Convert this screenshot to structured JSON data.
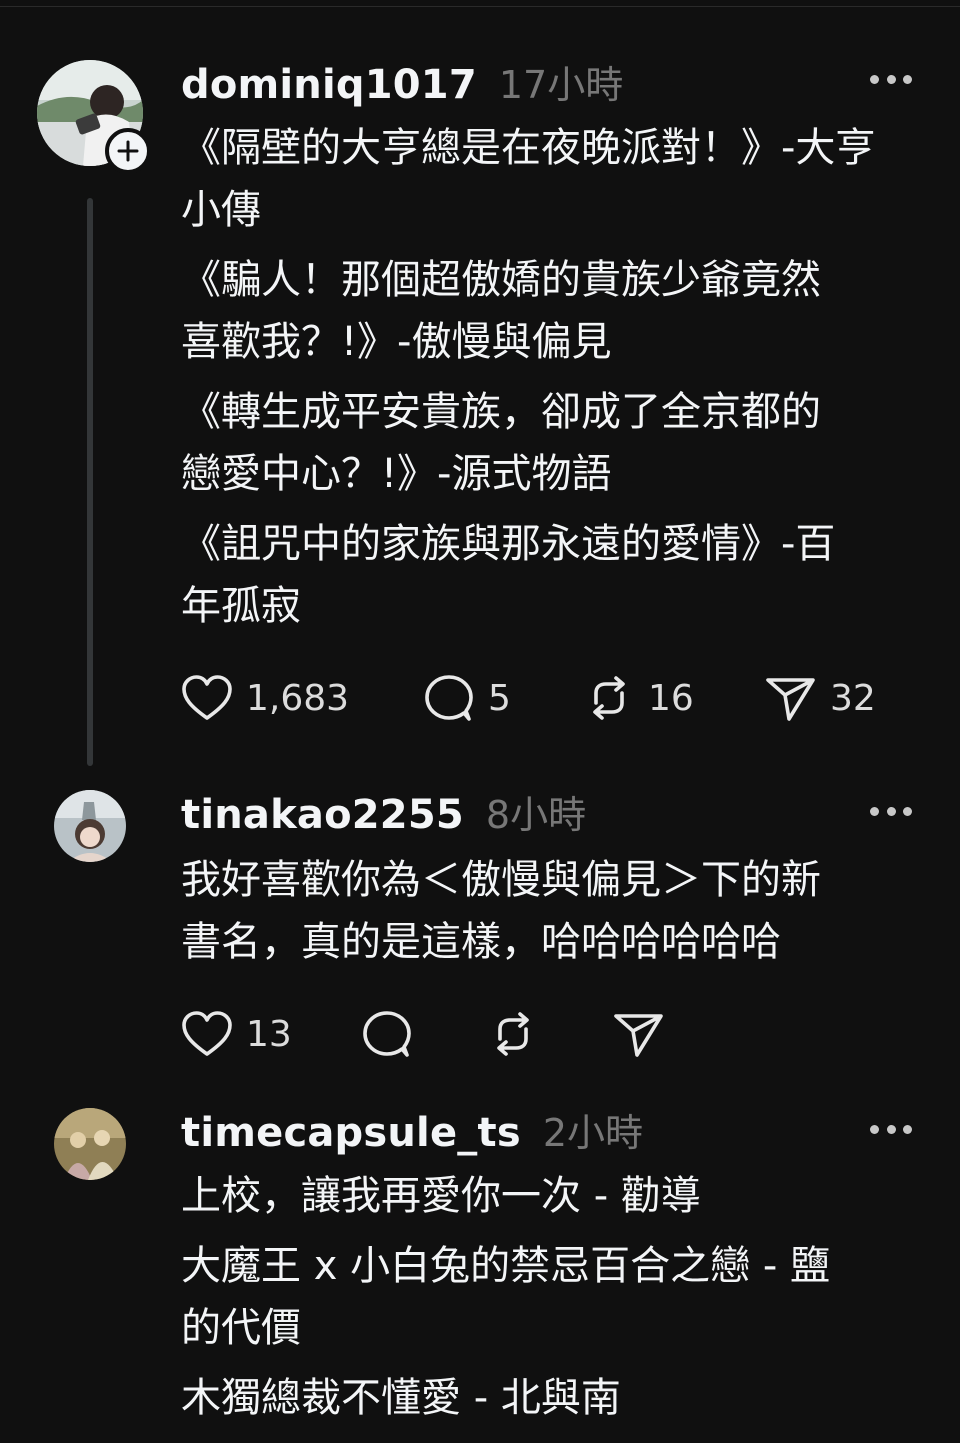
{
  "posts": [
    {
      "username": "dominiq1017",
      "time": "17小時",
      "lines": [
        "《隔壁的大亨總是在夜晚派對！》-大亨",
        "小傳",
        "《騙人！那個超傲嬌的貴族少爺竟然",
        "喜歡我？!》-傲慢與偏見",
        "《轉生成平安貴族，卻成了全京都的",
        "戀愛中心？!》-源式物語",
        "《詛咒中的家族與那永遠的愛情》-百",
        "年孤寂"
      ],
      "likes": "1,683",
      "comments": "5",
      "reposts": "16",
      "shares": "32",
      "avatar_colors": [
        "#7c8f86",
        "#d9d2c8",
        "#3a3331"
      ]
    },
    {
      "username": "tinakao2255",
      "time": "8小時",
      "lines": [
        "我好喜歡你為＜傲慢與偏見＞下的新",
        "書名，真的是這樣，哈哈哈哈哈哈"
      ],
      "likes": "13",
      "avatar_colors": [
        "#a8b0b6",
        "#e6d8cf",
        "#5b4a42"
      ]
    },
    {
      "username": "timecapsule_ts",
      "time": "2小時",
      "lines": [
        "上校，讓我再愛你一次 - 勸導",
        "大魔王 x 小白兔的禁忌百合之戀 - 鹽",
        "的代價",
        "木獨總裁不懂愛 - 北與南"
      ],
      "avatar_colors": [
        "#8a7a4e",
        "#d9c79a",
        "#5b4f3a"
      ]
    }
  ],
  "icons": {
    "like": "heart-icon",
    "comment": "comment-bubble-icon",
    "repost": "repost-icon",
    "share": "share-send-icon",
    "more": "more-dots-icon",
    "follow": "plus-icon"
  },
  "colors": {
    "background": "#101010",
    "text": "#f3f5f7",
    "secondary": "#777777",
    "thread_line": "#333638"
  }
}
